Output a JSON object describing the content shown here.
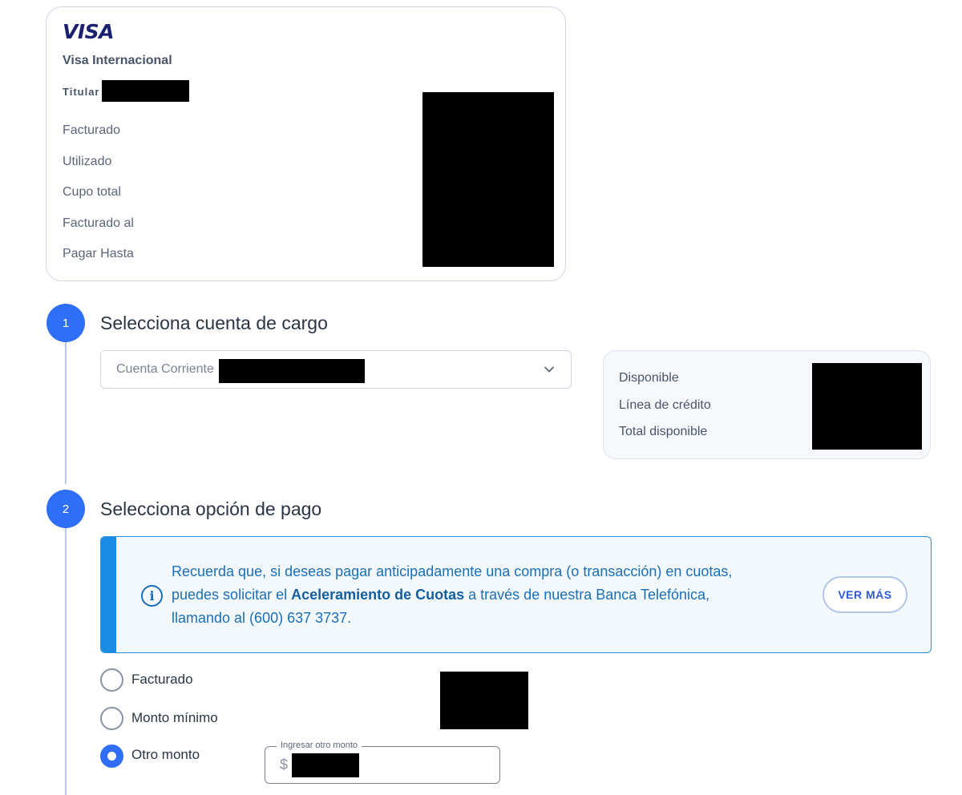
{
  "card": {
    "brand": "VISA",
    "name": "Visa Internacional",
    "holder_label": "Titular",
    "rows": [
      "Facturado",
      "Utilizado",
      "Cupo total",
      "Facturado al",
      "Pagar Hasta"
    ]
  },
  "step1": {
    "number": "1",
    "title": "Selecciona cuenta de cargo",
    "account_select": {
      "value": "Cuenta Corriente"
    },
    "balance": [
      "Disponible",
      "Línea de crédito",
      "Total disponible"
    ]
  },
  "step2": {
    "number": "2",
    "title": "Selecciona opción de pago",
    "info": {
      "text_before": "Recuerda que, si deseas pagar anticipadamente una compra (o transacción) en cuotas, puedes solicitar el ",
      "text_bold": "Aceleramiento de Cuotas",
      "text_after": " a través de nuestra Banca Telefónica, llamando al (600) 637 3737.",
      "button": "VER MÁS"
    },
    "options": [
      {
        "label": "Facturado",
        "selected": false
      },
      {
        "label": "Monto mínimo",
        "selected": false
      },
      {
        "label": "Otro monto",
        "selected": true
      }
    ],
    "amount_input": {
      "legend": "Ingresar otro monto",
      "prefix": "$"
    }
  },
  "colors": {
    "accent": "#2f6ef6",
    "info": "#1a8be3",
    "visa": "#1a1f71"
  }
}
